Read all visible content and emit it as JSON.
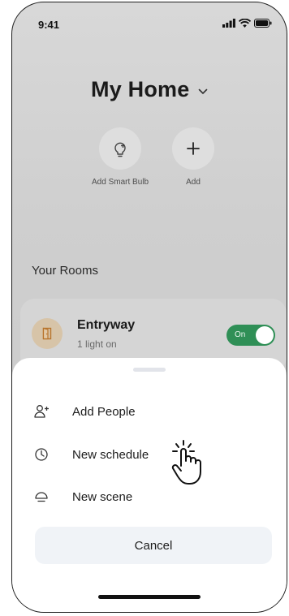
{
  "status_bar": {
    "time": "9:41"
  },
  "header": {
    "title": "My Home"
  },
  "quick_actions": [
    {
      "label": "Add Smart Bulb",
      "icon": "bulb-plus-icon"
    },
    {
      "label": "Add",
      "icon": "plus-icon"
    }
  ],
  "rooms": {
    "heading": "Your Rooms",
    "items": [
      {
        "name": "Entryway",
        "subtitle": "1 light on",
        "toggle_label": "On",
        "toggle_on": true,
        "icon": "door-icon"
      }
    ]
  },
  "sheet": {
    "items": [
      {
        "label": "Add People",
        "icon": "add-person-icon"
      },
      {
        "label": "New schedule",
        "icon": "clock-icon"
      },
      {
        "label": "New scene",
        "icon": "lamp-icon"
      }
    ],
    "cancel_label": "Cancel"
  },
  "colors": {
    "toggle_on": "#2f8f56",
    "sheet_bg": "#ffffff",
    "cancel_bg": "#f0f3f7",
    "dim_bg": "#cfcfcf"
  }
}
